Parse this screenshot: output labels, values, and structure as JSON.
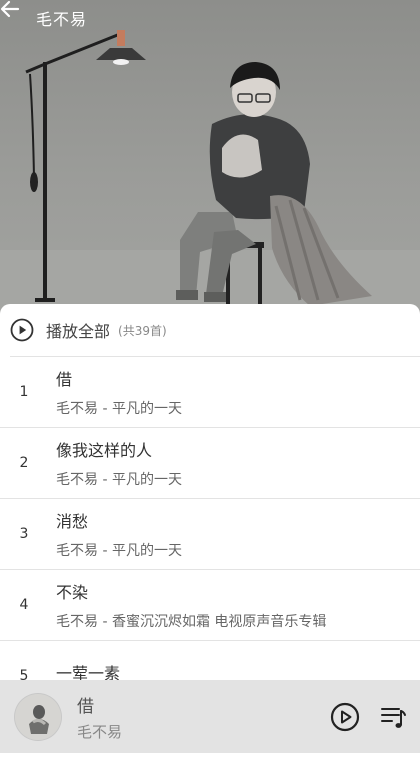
{
  "header": {
    "title": "毛不易",
    "back_icon": "arrow-left-icon"
  },
  "play_all": {
    "label": "播放全部",
    "count": "(共39首)",
    "icon": "play-circle-icon"
  },
  "songs": [
    {
      "index": "1",
      "name": "借",
      "subtitle": "毛不易 - 平凡的一天"
    },
    {
      "index": "2",
      "name": "像我这样的人",
      "subtitle": "毛不易 - 平凡的一天"
    },
    {
      "index": "3",
      "name": "消愁",
      "subtitle": "毛不易 - 平凡的一天"
    },
    {
      "index": "4",
      "name": "不染",
      "subtitle": "毛不易 - 香蜜沉沉烬如霜 电视原声音乐专辑"
    },
    {
      "index": "5",
      "name": "一荤一素",
      "subtitle": ""
    }
  ],
  "player": {
    "title": "借",
    "artist": "毛不易",
    "play_icon": "play-circle-icon",
    "playlist_icon": "playlist-icon"
  },
  "colors": {
    "divider": "#e3e3e3",
    "player_bg": "#e3e3e3",
    "text_primary": "#333333",
    "text_secondary": "#666666"
  }
}
